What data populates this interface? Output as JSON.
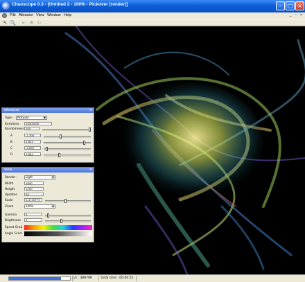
{
  "window": {
    "title": "Chaoscope 0.3 - [Untitled 2 - 100% - Pickover (render)]"
  },
  "menu": {
    "items": [
      "File",
      "Attractor",
      "View",
      "Window",
      "Help"
    ]
  },
  "attractor_panel": {
    "title": "attractor",
    "type_label": "Type :",
    "type_value": "Pickover",
    "iterations_label": "Iterations",
    "iterations_value": "20000000",
    "randomness_label": "Randomness",
    "randomness_value": "100",
    "params": [
      {
        "label": "A",
        "value": "-1.300",
        "level": 0.35
      },
      {
        "label": "B",
        "value": "2.653",
        "level": 0.88
      },
      {
        "label": "C",
        "value": "-2.850",
        "level": 0.05
      },
      {
        "label": "D",
        "value": "1.864",
        "level": 0.32
      }
    ]
  },
  "view_panel": {
    "title": "view",
    "render_label": "Render :",
    "render_value": "Light",
    "width_label": "Width",
    "width_value": "1600",
    "height_label": "Height",
    "height_value": "1200",
    "updates_label": "Updates",
    "updates_value": "30",
    "scale_label": "Scale",
    "scale_value": "0.4740773",
    "scale_level": 0.45,
    "zoom_label": "Zoom",
    "zoom_value": "100%",
    "gamma_label": "Gamma",
    "gamma_value": "3",
    "gamma_level": 0.05,
    "brightness_label": "Brightness",
    "brightness_value": "4",
    "brightness_level": 0.35,
    "speed_grad_label": "Speed Grad.",
    "angle_grad_label": "Angle Grad."
  },
  "status": {
    "progress": 0.85,
    "iterations_text": "i/s : 389799",
    "time_text": "total time : 00:00:51"
  },
  "colors": {
    "titlebar": "#0a5fd8",
    "panel_title": "#4a74d9",
    "progress": "#3a6fe8"
  }
}
